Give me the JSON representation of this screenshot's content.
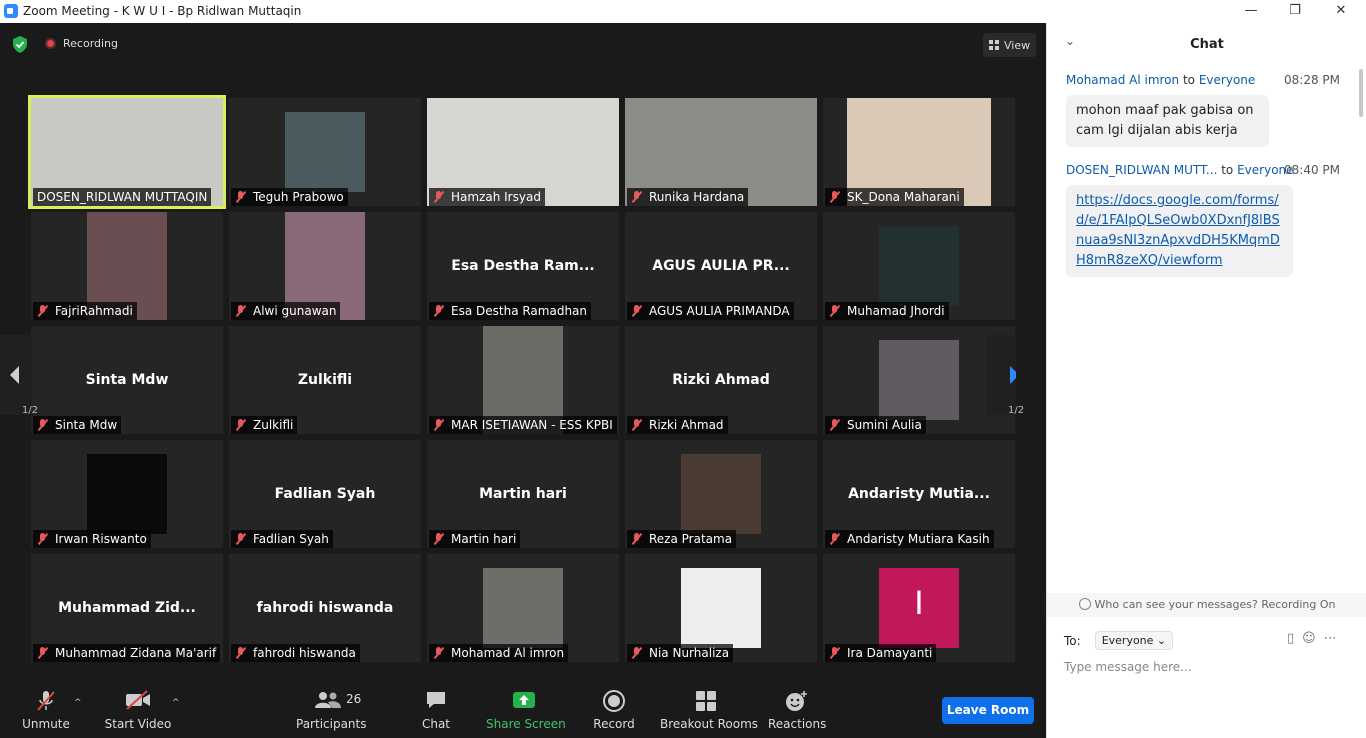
{
  "window": {
    "title": "Zoom Meeting - K W U I - Bp Ridlwan Muttaqin",
    "minimize": "—",
    "maximize": "❐",
    "close": "✕"
  },
  "topbar": {
    "recording_label": "Recording",
    "view_label": "View"
  },
  "pagination": {
    "left": "1/2",
    "right": "1/2"
  },
  "tiles": [
    {
      "name": "DOSEN_RIDLWAN MUTTAQIN",
      "big": "",
      "video": "#c9c9c4",
      "active": true
    },
    {
      "name": "Teguh Prabowo",
      "big": "",
      "video": "#4b5a5e"
    },
    {
      "name": "Hamzah Irsyad",
      "big": "",
      "video": "#d8d6d2"
    },
    {
      "name": "Runika Hardana",
      "big": "",
      "video": "#8a8e86"
    },
    {
      "name": "SK_Dona Maharani",
      "big": "",
      "video": "#d9c9b6"
    },
    {
      "name": "FajriRahmadi",
      "big": "",
      "video": "#6a4f52"
    },
    {
      "name": "Alwi gunawan",
      "big": "",
      "video": "#8a6a78"
    },
    {
      "name": "Esa Destha Ramadhan",
      "big": "Esa Destha Ram...",
      "video": ""
    },
    {
      "name": "AGUS AULIA PRIMANDA",
      "big": "AGUS AULIA PR...",
      "video": ""
    },
    {
      "name": "Muhamad Jhordi",
      "big": "",
      "video": "#223030"
    },
    {
      "name": "Sinta Mdw",
      "big": "Sinta Mdw",
      "video": ""
    },
    {
      "name": "Zulkifli",
      "big": "Zulkifli",
      "video": ""
    },
    {
      "name": "MAR ISETIAWAN - ESS KPBI",
      "big": "",
      "video": "#6d6b66"
    },
    {
      "name": "Rizki Ahmad",
      "big": "Rizki Ahmad",
      "video": ""
    },
    {
      "name": "Sumini Aulia",
      "big": "",
      "video": "#5e5a60"
    },
    {
      "name": "Irwan Riswanto",
      "big": "",
      "video": "#0a0a0a"
    },
    {
      "name": "Fadlian Syah",
      "big": "Fadlian Syah",
      "video": ""
    },
    {
      "name": "Martin hari",
      "big": "Martin hari",
      "video": ""
    },
    {
      "name": "Reza Pratama",
      "big": "",
      "video": "#4a3b33"
    },
    {
      "name": "Andaristy Mutiara Kasih",
      "big": "Andaristy  Mutia...",
      "video": ""
    },
    {
      "name": "Muhammad Zidana Ma'arif",
      "big": "Muhammad  Zid...",
      "video": ""
    },
    {
      "name": "fahrodi hiswanda",
      "big": "fahrodi hiswanda",
      "video": ""
    },
    {
      "name": "Mohamad Al imron",
      "big": "",
      "video": "#6f6d68"
    },
    {
      "name": "Nia Nurhaliza",
      "big": "",
      "video": "#eeeeee"
    },
    {
      "name": "Ira Damayanti",
      "big": "I",
      "video": "#c0185a"
    }
  ],
  "toolbar": {
    "unmute": "Unmute",
    "start_video": "Start Video",
    "participants": "Participants",
    "participant_count": "26",
    "chat": "Chat",
    "share_screen": "Share Screen",
    "record": "Record",
    "breakout_rooms": "Breakout Rooms",
    "reactions": "Reactions",
    "leave_room": "Leave Room"
  },
  "chat": {
    "title": "Chat",
    "messages": [
      {
        "sender": "Mohamad Al imron",
        "to": "to",
        "recipient": "Everyone",
        "time": "08:28 PM",
        "text": "mohon maaf pak gabisa on cam lgi dijalan abis kerja"
      },
      {
        "sender": "DOSEN_RIDLWAN MUTT...",
        "to": "to",
        "recipient": "Everyone",
        "time": "08:40 PM",
        "text": "https://docs.google.com/forms/d/e/1FAIpQLSeOwb0XDxnfJ8lBSnuaa9sNI3znApxvdDH5KMqmDH8mR8zeXQ/viewform"
      }
    ],
    "notice": "Who can see your messages? Recording On",
    "to_label": "To:",
    "to_value": "Everyone",
    "input_placeholder": "Type message here..."
  }
}
